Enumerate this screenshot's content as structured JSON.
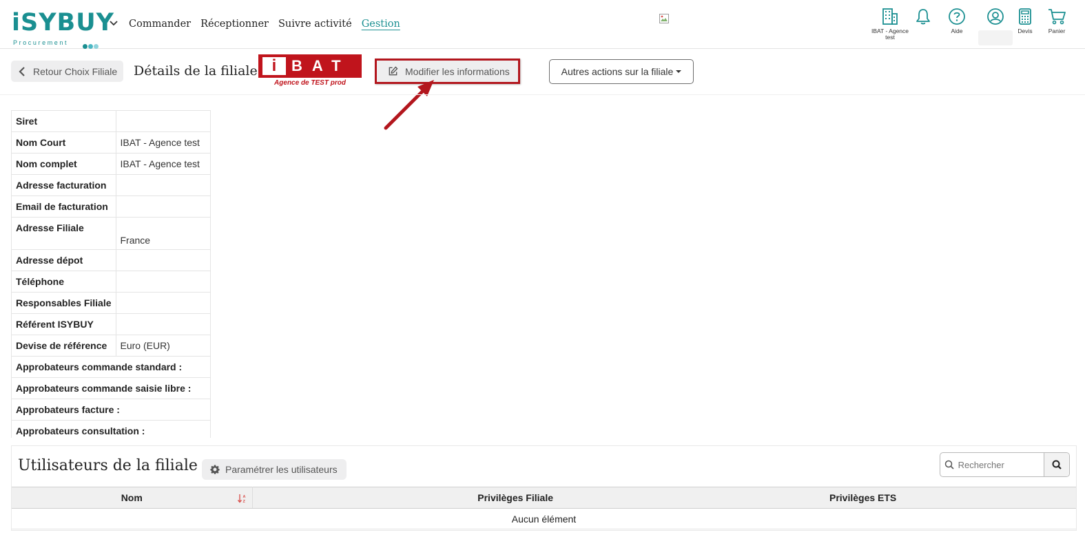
{
  "brand": {
    "logo_text": "iSYBUY",
    "logo_subtext": "Procurement",
    "colors": {
      "primary": "#1a8f91",
      "dot1": "#1a8f91",
      "dot2": "#4cb8c4",
      "dot3": "#8fd3dc",
      "accent_red": "#c0141c"
    }
  },
  "nav": {
    "items": [
      {
        "label": "Commander",
        "active": false
      },
      {
        "label": "Réceptionner",
        "active": false
      },
      {
        "label": "Suivre activité",
        "active": false
      },
      {
        "label": "Gestion",
        "active": true
      }
    ]
  },
  "toolbar": {
    "company_label": "IBAT - Agence test",
    "notifications_icon": "bell-icon",
    "help_label": "Aide",
    "account_icon": "user-circle-icon",
    "quotes_label": "Devis",
    "cart_label": "Panier"
  },
  "header": {
    "back_label": "Retour Choix Filiale",
    "title": "Détails de la filiale",
    "company_logo_letters": "BAT",
    "company_logo_i": "i",
    "company_logo_sub": "Agence de TEST prod",
    "modify_label": "Modifier les informations",
    "other_actions_label": "Autres actions sur la filiale"
  },
  "details": {
    "rows": [
      {
        "key": "Siret",
        "value": ""
      },
      {
        "key": "Nom Court",
        "value": "IBAT - Agence test"
      },
      {
        "key": "Nom complet",
        "value": "IBAT - Agence test"
      },
      {
        "key": "Adresse facturation",
        "value": ""
      },
      {
        "key": "Email de facturation",
        "value": ""
      },
      {
        "key": "Adresse Filiale",
        "value": "France"
      },
      {
        "key": "Adresse dépot",
        "value": ""
      },
      {
        "key": "Téléphone",
        "value": ""
      },
      {
        "key": "Responsables Filiale",
        "value": ""
      },
      {
        "key": "Référent ISYBUY",
        "value": ""
      },
      {
        "key": "Devise de référence",
        "value": "Euro (EUR)"
      },
      {
        "key": "Approbateurs commande standard :",
        "value": ""
      },
      {
        "key": "Approbateurs commande saisie libre :",
        "value": ""
      },
      {
        "key": "Approbateurs facture :",
        "value": ""
      },
      {
        "key": "Approbateurs consultation :",
        "value": ""
      }
    ]
  },
  "users": {
    "title": "Utilisateurs de la filiale",
    "param_label": "Paramétrer les utilisateurs",
    "search_placeholder": "Rechercher",
    "columns": [
      "Nom",
      "Privilèges Filiale",
      "Privilèges ETS"
    ],
    "empty_text": "Aucun élément"
  }
}
